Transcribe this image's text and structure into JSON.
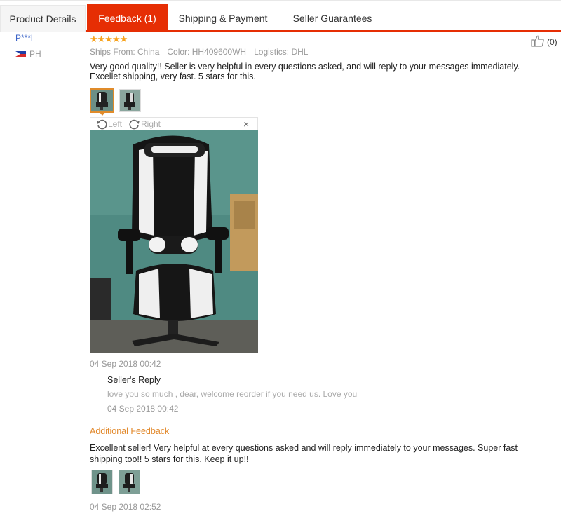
{
  "tabs": [
    {
      "label": "Product Details"
    },
    {
      "label": "Feedback (1)",
      "active": true
    },
    {
      "label": "Shipping & Payment"
    },
    {
      "label": "Seller Guarantees"
    }
  ],
  "reviewer": {
    "name": "P***l",
    "country": "PH"
  },
  "review": {
    "rating": 5,
    "stars": "★★★★★",
    "helpful_count": "(0)",
    "ships_from": "Ships From: China",
    "color": "Color: HH409600WH",
    "logistics": "Logistics: DHL",
    "text": "Very good quality!! Seller is very helpful in every questions asked, and will reply to your messages immediately. Excellet shipping, very fast. 5 stars for this.",
    "date": "04 Sep 2018 00:42"
  },
  "viewer": {
    "rotate_left": "Left",
    "rotate_right": "Right",
    "close": "×"
  },
  "seller_reply": {
    "title": "Seller's Reply",
    "text": "love you so much , dear, welcome reorder if you need us. Love you",
    "date": "04 Sep 2018 00:42"
  },
  "additional_feedback": {
    "title": "Additional Feedback",
    "text": "Excellent seller! Very helpful at every questions asked and will reply immediately to your messages. Super fast shipping too!! 5 stars for this. Keep it up!!",
    "date": "04 Sep 2018 02:52"
  },
  "colors": {
    "accent": "#e62e04",
    "star": "#f7a21c",
    "additional": "#e28a2e",
    "link": "#3a63c7"
  },
  "icons": [
    "thumbs-up-icon",
    "rotate-left-icon",
    "rotate-right-icon",
    "close-icon",
    "flag-icon"
  ]
}
